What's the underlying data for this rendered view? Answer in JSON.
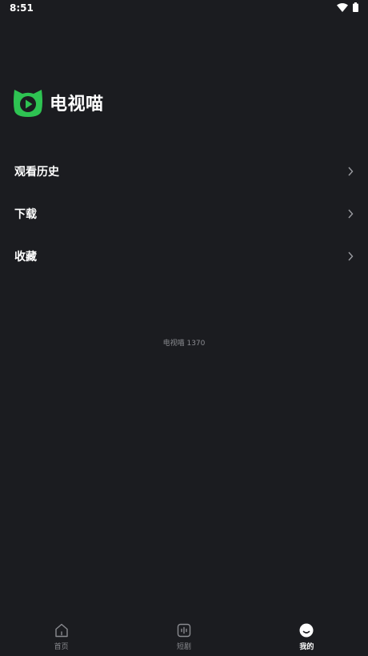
{
  "status_bar": {
    "time": "8:51"
  },
  "brand": {
    "name": "电视喵",
    "logo_color": "#2ec352"
  },
  "menu": {
    "items": [
      {
        "label": "观看历史"
      },
      {
        "label": "下载"
      },
      {
        "label": "收藏"
      }
    ]
  },
  "version_text": "电视喵 1370",
  "tabbar": {
    "tabs": [
      {
        "label": "首页",
        "icon": "home-icon",
        "active": false
      },
      {
        "label": "短剧",
        "icon": "short-drama-icon",
        "active": false
      },
      {
        "label": "我的",
        "icon": "profile-icon",
        "active": true
      }
    ]
  },
  "colors": {
    "background": "#1b1c20",
    "accent": "#2ec352",
    "muted_text": "#8a8b90"
  }
}
